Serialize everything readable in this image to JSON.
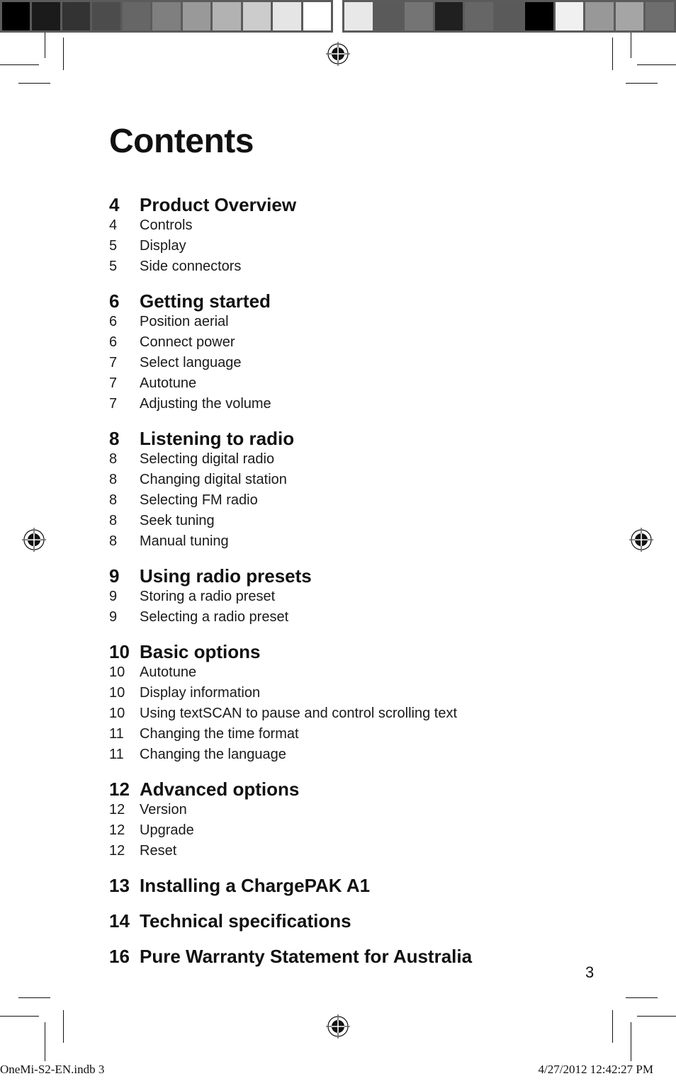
{
  "colorbar": {
    "left": [
      "#000000",
      "#1b1b1b",
      "#333333",
      "#4c4c4c",
      "#666666",
      "#7f7f7f",
      "#999999",
      "#b2b2b2",
      "#cccccc",
      "#e5e5e5",
      "#ffffff"
    ],
    "right": [
      "#e8e8e8",
      "#5a5a5a",
      "#747474",
      "#202020",
      "#666666",
      "#5a5a5a",
      "#000000",
      "#f0f0f0",
      "#989898",
      "#a5a5a5",
      "#6e6e6e"
    ]
  },
  "title": "Contents",
  "sections": [
    {
      "page": "4",
      "title": "Product Overview",
      "items": [
        {
          "page": "4",
          "label": "Controls"
        },
        {
          "page": "5",
          "label": "Display"
        },
        {
          "page": "5",
          "label": "Side connectors"
        }
      ]
    },
    {
      "page": "6",
      "title": "Getting started",
      "items": [
        {
          "page": "6",
          "label": "Position aerial"
        },
        {
          "page": "6",
          "label": "Connect power"
        },
        {
          "page": "7",
          "label": "Select language"
        },
        {
          "page": "7",
          "label": "Autotune"
        },
        {
          "page": "7",
          "label": "Adjusting the volume"
        }
      ]
    },
    {
      "page": "8",
      "title": "Listening to radio",
      "items": [
        {
          "page": "8",
          "label": "Selecting digital radio"
        },
        {
          "page": "8",
          "label": "Changing digital station"
        },
        {
          "page": "8",
          "label": "Selecting FM radio"
        },
        {
          "page": "8",
          "label": "Seek tuning"
        },
        {
          "page": "8",
          "label": "Manual tuning"
        }
      ]
    },
    {
      "page": "9",
      "title": "Using radio presets",
      "items": [
        {
          "page": "9",
          "label": "Storing a radio preset"
        },
        {
          "page": "9",
          "label": "Selecting a radio preset"
        }
      ]
    },
    {
      "page": "10",
      "title": "Basic options",
      "items": [
        {
          "page": "10",
          "label": "Autotune"
        },
        {
          "page": "10",
          "label": "Display information"
        },
        {
          "page": "10",
          "label": "Using textSCAN to pause and control scrolling text"
        },
        {
          "page": "11",
          "label": "Changing the time format"
        },
        {
          "page": "11",
          "label": "Changing the language"
        }
      ]
    },
    {
      "page": "12",
      "title": "Advanced options",
      "items": [
        {
          "page": "12",
          "label": "Version"
        },
        {
          "page": "12",
          "label": "Upgrade"
        },
        {
          "page": "12",
          "label": "Reset"
        }
      ]
    },
    {
      "page": "13",
      "title": "Installing a ChargePAK A1",
      "items": []
    },
    {
      "page": "14",
      "title": "Technical specifications",
      "items": []
    },
    {
      "page": "16",
      "title": "Pure Warranty Statement for Australia",
      "items": []
    }
  ],
  "page_number": "3",
  "slug": {
    "file": "OneMi-S2-EN.indb   3",
    "timestamp": "4/27/2012   12:42:27 PM"
  }
}
